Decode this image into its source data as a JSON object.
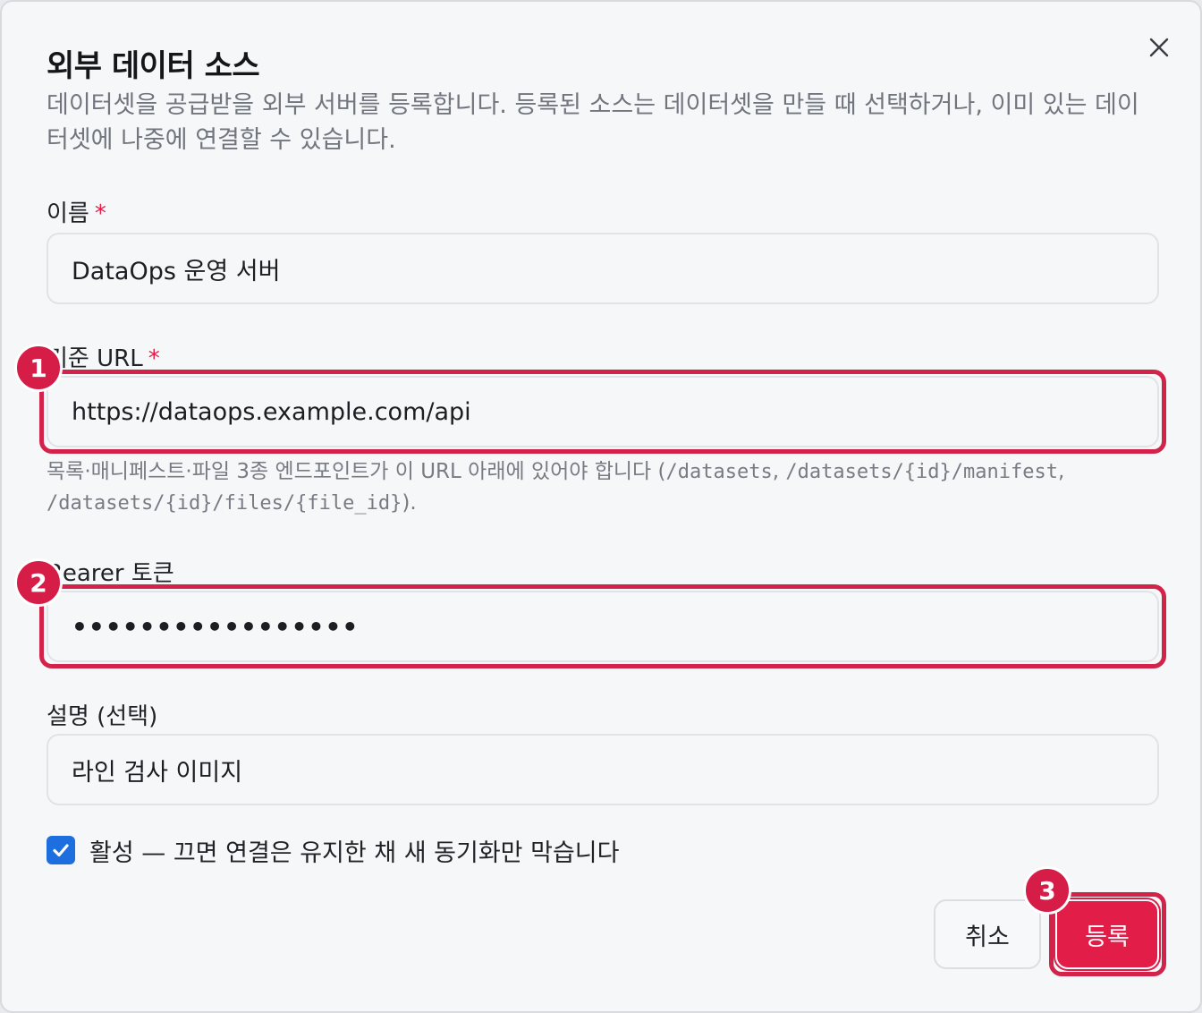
{
  "dialog": {
    "title": "외부 데이터 소스",
    "description": "데이터셋을 공급받을 외부 서버를 등록합니다. 등록된 소스는 데이터셋을 만들 때 선택하거나, 이미 있는 데이터셋에 나중에 연결할 수 있습니다.",
    "close_icon": "close-icon"
  },
  "form": {
    "name": {
      "label": "이름",
      "required_mark": "*",
      "value": "DataOps 운영 서버"
    },
    "base_url": {
      "label": "기준 URL",
      "required_mark": "*",
      "value": "https://dataops.example.com/api"
    },
    "hint": {
      "prefix": "목록·매니페스트·파일 3종 엔드포인트가 이 URL 아래에 있어야 합니다 (",
      "path1": "/datasets",
      "sep1": ", ",
      "path2": "/datasets/{id}/manifest",
      "sep2": ", ",
      "path3": "/datasets/{id}/files/{file_id}",
      "suffix": ")."
    },
    "token": {
      "label": "Bearer 토큰",
      "value": "•••••••••••••••••"
    },
    "desc": {
      "label": "설명 (선택)",
      "value": "라인 검사 이미지"
    },
    "active": {
      "checked": true,
      "label": "활성 — 끄면 연결은 유지한 채 새 동기화만 막습니다"
    }
  },
  "buttons": {
    "cancel": "취소",
    "submit": "등록"
  },
  "annotations": {
    "badge1": "1",
    "badge2": "2",
    "badge3": "3"
  },
  "colors": {
    "accent": "#e11d48",
    "checkbox": "#1d6fe0",
    "annotation": "#d2244a"
  }
}
